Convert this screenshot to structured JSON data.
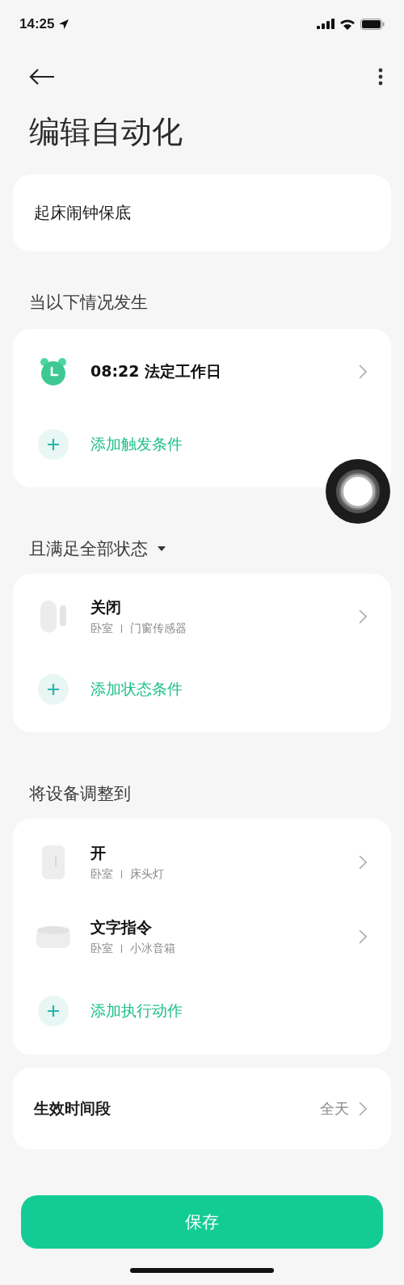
{
  "status_bar": {
    "time": "14:25"
  },
  "header": {
    "title": "编辑自动化"
  },
  "name_field": {
    "value": "起床闹钟保底"
  },
  "sections": [
    {
      "heading": "当以下情况发生",
      "items": [
        {
          "kind": "alarm",
          "title": "08:22 法定工作日"
        },
        {
          "kind": "add",
          "label": "添加触发条件"
        }
      ]
    },
    {
      "heading": "且满足全部状态",
      "dropdown": true,
      "items": [
        {
          "kind": "door-sensor",
          "title": "关闭",
          "room": "卧室",
          "device": "门窗传感器"
        },
        {
          "kind": "add",
          "label": "添加状态条件"
        }
      ]
    },
    {
      "heading": "将设备调整到",
      "items": [
        {
          "kind": "lamp",
          "title": "开",
          "room": "卧室",
          "device": "床头灯"
        },
        {
          "kind": "speaker",
          "title": "文字指令",
          "room": "卧室",
          "device": "小冰音箱"
        },
        {
          "kind": "add",
          "label": "添加执行动作"
        }
      ]
    }
  ],
  "period": {
    "label": "生效时间段",
    "value": "全天"
  },
  "save_button": {
    "label": "保存"
  }
}
